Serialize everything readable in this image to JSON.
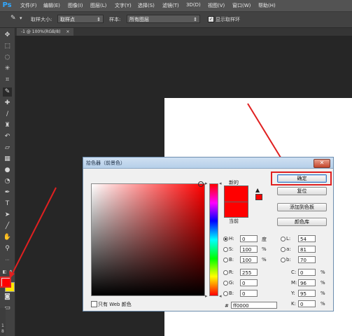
{
  "app": {
    "logo": "Ps"
  },
  "menubar": {
    "items": [
      "文件(F)",
      "编辑(E)",
      "图像(I)",
      "图层(L)",
      "文字(Y)",
      "选择(S)",
      "滤镜(T)",
      "3D(D)",
      "视图(V)",
      "窗口(W)",
      "帮助(H)"
    ]
  },
  "options": {
    "sample_size_label": "取样大小:",
    "sample_size_value": "取样点",
    "sample_label": "样本:",
    "sample_value": "所有图层",
    "show_ring_label": "显示取样环"
  },
  "document": {
    "tab_label": "-1 @ 100%(RGB/8)",
    "tab_close": "×"
  },
  "dialog": {
    "title": "拾色器（前景色）",
    "close_glyph": "✕",
    "new_label": "新的",
    "current_label": "当前",
    "buttons": {
      "ok": "确定",
      "reset": "复位",
      "add_to_swatches": "添加到色板",
      "color_libraries": "颜色库"
    },
    "web_only_label": "只有 Web 颜色",
    "fields": {
      "H": {
        "label": "H:",
        "value": "0",
        "unit": "度"
      },
      "S": {
        "label": "S:",
        "value": "100",
        "unit": "%"
      },
      "B": {
        "label": "B:",
        "value": "100",
        "unit": "%"
      },
      "R": {
        "label": "R:",
        "value": "255"
      },
      "G": {
        "label": "G:",
        "value": "0"
      },
      "Bl": {
        "label": "B:",
        "value": "0"
      },
      "L": {
        "label": "L:",
        "value": "54"
      },
      "a": {
        "label": "a:",
        "value": "81"
      },
      "b": {
        "label": "b:",
        "value": "70"
      },
      "C": {
        "label": "C:",
        "value": "0",
        "unit": "%"
      },
      "M": {
        "label": "M:",
        "value": "96",
        "unit": "%"
      },
      "Y": {
        "label": "Y:",
        "value": "95",
        "unit": "%"
      },
      "K": {
        "label": "K:",
        "value": "0",
        "unit": "%"
      },
      "hex": {
        "label": "#",
        "value": "ff0000"
      }
    }
  },
  "ruler": {
    "marks": [
      "1",
      "8"
    ]
  },
  "colors": {
    "foreground": "#ff0000",
    "background": "#ffe600",
    "annotation": "#e02020"
  }
}
